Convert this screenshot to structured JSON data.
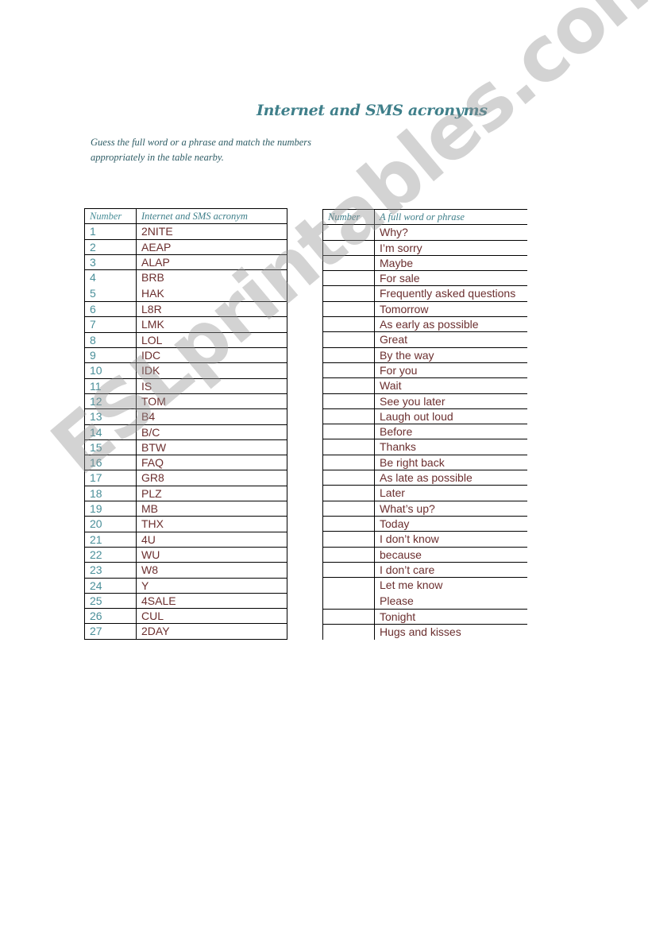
{
  "title": "Internet and SMS acronyms",
  "instructions": [
    "Guess the full word or a phrase and match the numbers",
    "appropriately in the table nearby."
  ],
  "table_left": {
    "headers": [
      "Number",
      "Internet and SMS acronym"
    ],
    "rows": [
      {
        "num": "1",
        "acr": "2NITE"
      },
      {
        "num": "2",
        "acr": "AEAP"
      },
      {
        "num": "3",
        "acr": "ALAP"
      },
      {
        "num": "4\n5",
        "acr": "BRB\nHAK"
      },
      {
        "num": "6",
        "acr": "L8R"
      },
      {
        "num": "7",
        "acr": "LMK"
      },
      {
        "num": "8",
        "acr": "LOL"
      },
      {
        "num": "9",
        "acr": "IDC"
      },
      {
        "num": "10",
        "acr": "IDK"
      },
      {
        "num": "11",
        "acr": "IS"
      },
      {
        "num": "12",
        "acr": "TOM"
      },
      {
        "num": "13",
        "acr": "B4"
      },
      {
        "num": "14",
        "acr": "B/C"
      },
      {
        "num": "15",
        "acr": "BTW"
      },
      {
        "num": "16",
        "acr": "FAQ"
      },
      {
        "num": "17",
        "acr": "GR8"
      },
      {
        "num": "18",
        "acr": "PLZ"
      },
      {
        "num": "19",
        "acr": "MB"
      },
      {
        "num": "20",
        "acr": "THX"
      },
      {
        "num": "21",
        "acr": "4U"
      },
      {
        "num": "22",
        "acr": "WU"
      },
      {
        "num": "23",
        "acr": "W8"
      },
      {
        "num": "24",
        "acr": "Y"
      },
      {
        "num": "25",
        "acr": "4SALE"
      },
      {
        "num": "26",
        "acr": "CUL"
      },
      {
        "num": "27",
        "acr": "2DAY"
      }
    ]
  },
  "table_right": {
    "headers": [
      "Number",
      "A full  word or phrase"
    ],
    "rows": [
      "Why?",
      "I’m sorry",
      "Maybe",
      "For sale",
      "Frequently asked questions",
      "Tomorrow",
      "As early as possible",
      "Great",
      "By the way",
      "For you",
      "Wait",
      "See you later",
      "Laugh out loud",
      "Before",
      "Thanks",
      "Be right back",
      "As late as possible",
      "Later",
      "What’s up?",
      "Today",
      " I don’t know",
      "because",
      "I don’t care",
      "Let me know\nPlease",
      "Tonight",
      "Hugs and kisses"
    ]
  },
  "watermark": "ESLprintables.com"
}
